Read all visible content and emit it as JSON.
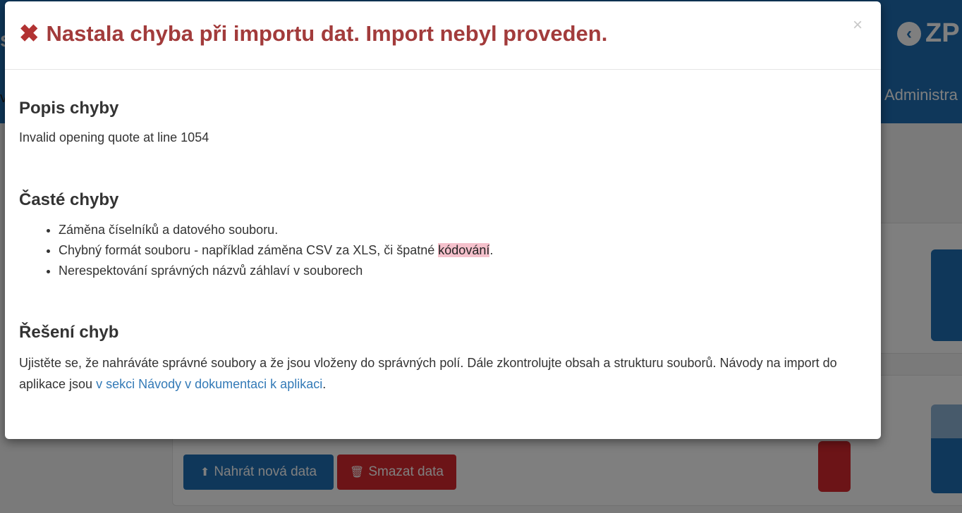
{
  "background": {
    "brand_text": "ZP",
    "brand_icon": "chevron-left-circle-icon",
    "nav_admin": "Administra",
    "left_fragment_1": "s",
    "left_fragment_2": "v",
    "upload_button": "Nahrát nová data",
    "delete_button": "Smazat data",
    "upload_icon": "upload-icon",
    "delete_icon": "trash-icon"
  },
  "modal": {
    "title": "Nastala chyba při importu dat. Import nebyl proveden.",
    "title_icon": "error-x-icon",
    "close_label": "×",
    "sections": {
      "description": {
        "heading": "Popis chyby",
        "text": "Invalid opening quote at line 1054"
      },
      "common_errors": {
        "heading": "Časté chyby",
        "items": [
          "Záměna číselníků a datového souboru.",
          "Chybný formát souboru - například záměna CSV za XLS, či špatné ",
          "Nerespektování správných názvů záhlaví v souborech"
        ],
        "item2_highlight": "kódování",
        "item2_end": "."
      },
      "solution": {
        "heading": "Řešení chyb",
        "text": "Ujistěte se, že nahráváte správné soubory a že jsou vloženy do správných polí. Dále zkontrolujte obsah a strukturu souborů. Návody na import do aplikace jsou ",
        "link": "v sekci Návody v dokumentaci k aplikaci",
        "text_end": "."
      }
    }
  },
  "colors": {
    "primary": "#1e6fb4",
    "danger": "#d9282e",
    "title_red": "#a23b3b",
    "highlight": "#f5c1cc",
    "link": "#337ab7"
  }
}
